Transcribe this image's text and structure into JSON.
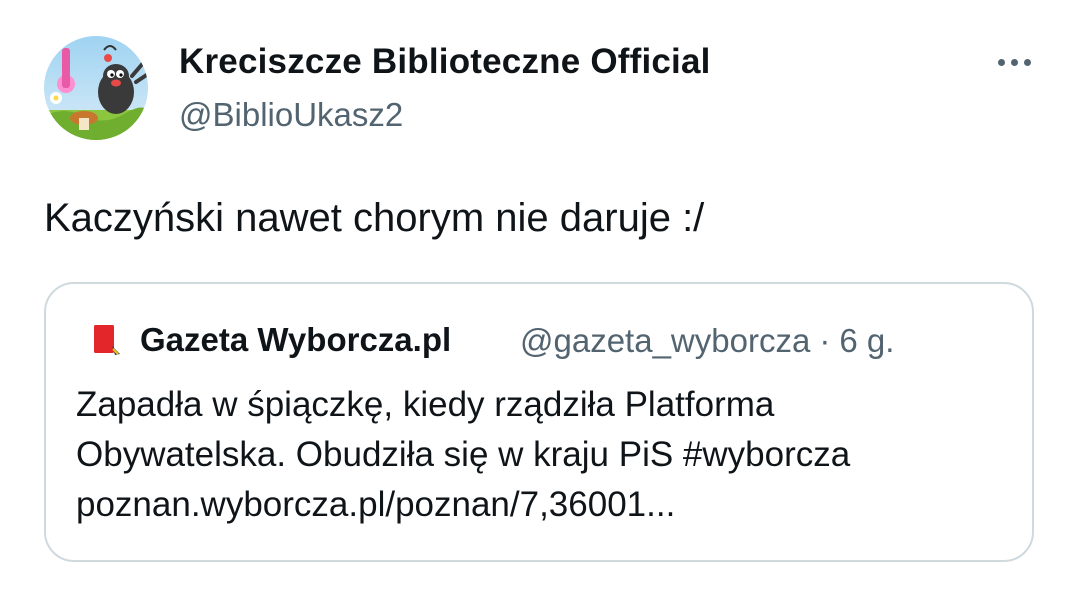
{
  "tweet": {
    "author": {
      "name": "Kreciszcze Biblioteczne Official",
      "handle": "@BiblioUkasz2",
      "avatar_icon": "mole-cartoon-avatar"
    },
    "more_icon": "more-horizontal-icon",
    "text": "Kaczyński nawet chorym nie daruje :/"
  },
  "quote": {
    "author": {
      "name": "Gazeta Wyborcza.pl",
      "handle": "@gazeta_wyborcza",
      "avatar_icon": "gazeta-wyborcza-logo",
      "brand_color": "#e3262a"
    },
    "separator": "·",
    "time": "6 g.",
    "lines": [
      "Zapadła w śpiączkę, kiedy rządziła Platforma",
      "Obywatelska. Obudziła się w kraju PiS #wyborcza",
      "poznan.wyborcza.pl/poznan/7,36001..."
    ]
  },
  "colors": {
    "text_primary": "#0f1419",
    "text_secondary": "#536471",
    "border": "#cfd9de"
  }
}
